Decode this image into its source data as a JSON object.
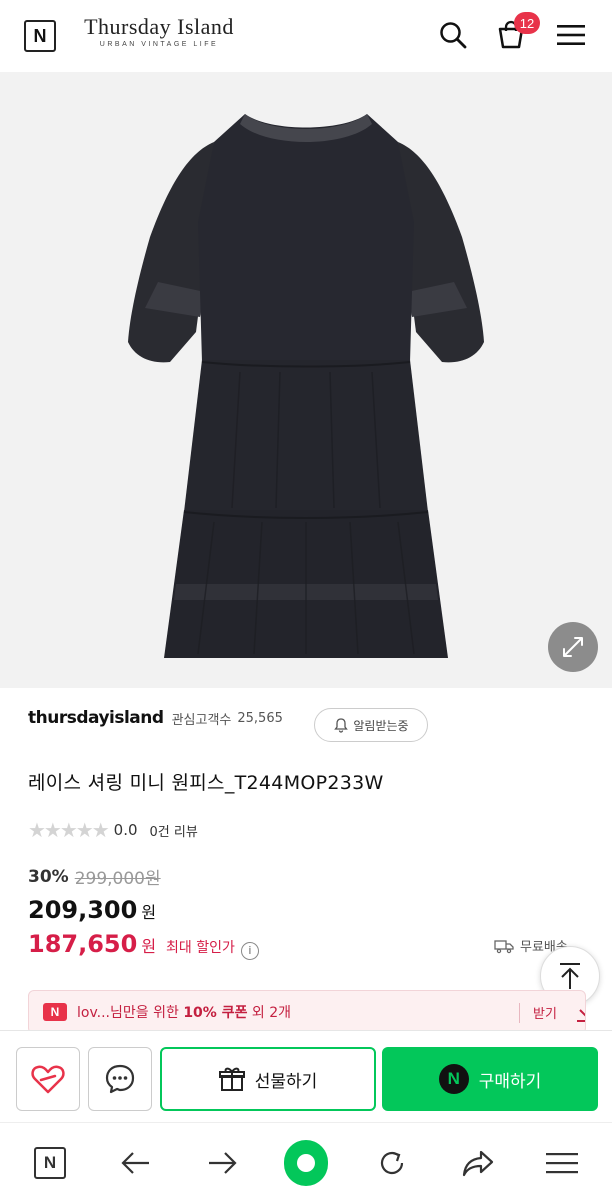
{
  "header": {
    "logo_letter": "N",
    "brand_title": "Thursday Island",
    "brand_subtitle": "URBAN VINTAGE LIFE",
    "cart_count": "12"
  },
  "product": {
    "store_name": "thursdayisland",
    "followers_label": "관심고객수",
    "followers_count": "25,565",
    "notify_label": "알림받는중",
    "name": "레이스 셔링 미니 원피스_T244MOP233W",
    "rating_stars": "★★★★★",
    "rating": "0.0",
    "review_count": "0건 리뷰",
    "discount_rate": "30%",
    "original_price": "299,000원",
    "price": "209,300",
    "price_unit": "원",
    "max_discount_price": "187,650",
    "max_discount_unit": "원",
    "max_discount_label": "최대 할인가",
    "info_icon": "i",
    "shipping": "무료배송"
  },
  "coupon": {
    "badge": "N",
    "prefix": "lov...님만을 위한 ",
    "highlight": "10% 쿠폰",
    "suffix": " 외 2개",
    "get_label": "받기"
  },
  "actions": {
    "gift_label": "선물하기",
    "buy_label": "구매하기",
    "npay_letter": "N"
  },
  "navbar": {
    "logo_letter": "N"
  },
  "colors": {
    "accent_green": "#03c75a",
    "sale_red": "#d61e48",
    "badge_red": "#e8334a",
    "product_bg": "#f2f2f2"
  }
}
